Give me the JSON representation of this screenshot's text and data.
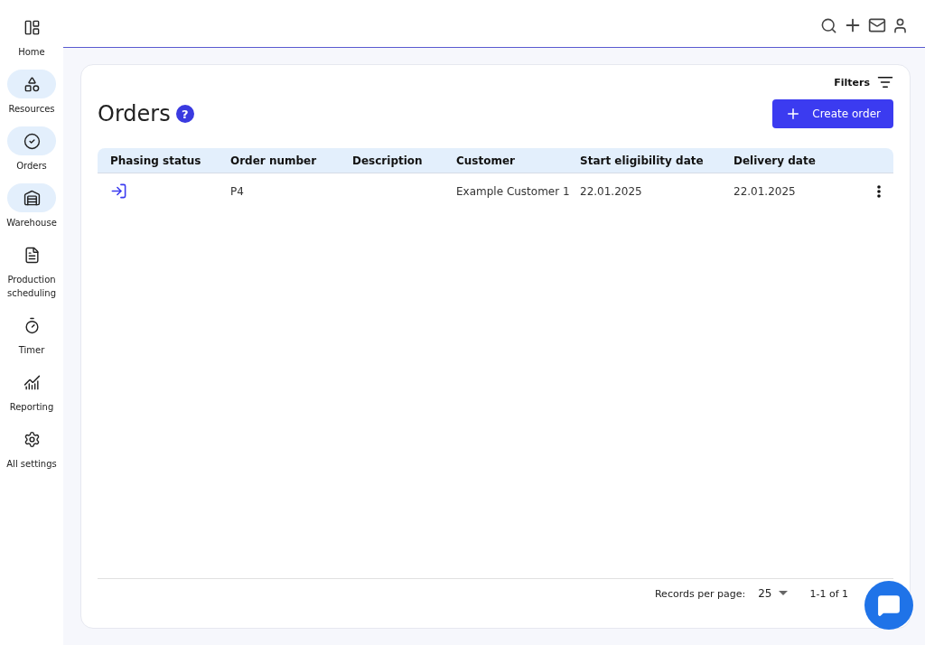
{
  "sidebar": {
    "items": [
      {
        "label": "Home",
        "highlighted": false
      },
      {
        "label": "Resources",
        "highlighted": true
      },
      {
        "label": "Orders",
        "highlighted": true
      },
      {
        "label": "Warehouse",
        "highlighted": true
      },
      {
        "label": "Production scheduling",
        "highlighted": false
      },
      {
        "label": "Timer",
        "highlighted": false
      },
      {
        "label": "Reporting",
        "highlighted": false
      },
      {
        "label": "All settings",
        "highlighted": false
      }
    ]
  },
  "page": {
    "title": "Orders",
    "help": "?",
    "filters": "Filters",
    "create_button": "Create order"
  },
  "table": {
    "columns": [
      "Phasing status",
      "Order number",
      "Description",
      "Customer",
      "Start eligibility date",
      "Delivery date"
    ],
    "rows": [
      {
        "order_number": "P4",
        "description": "",
        "customer": "Example Customer 1",
        "start_date": "22.01.2025",
        "delivery_date": "22.01.2025"
      }
    ]
  },
  "pagination": {
    "label": "Records per page:",
    "per_page": "25",
    "range": "1-1 of 1"
  }
}
